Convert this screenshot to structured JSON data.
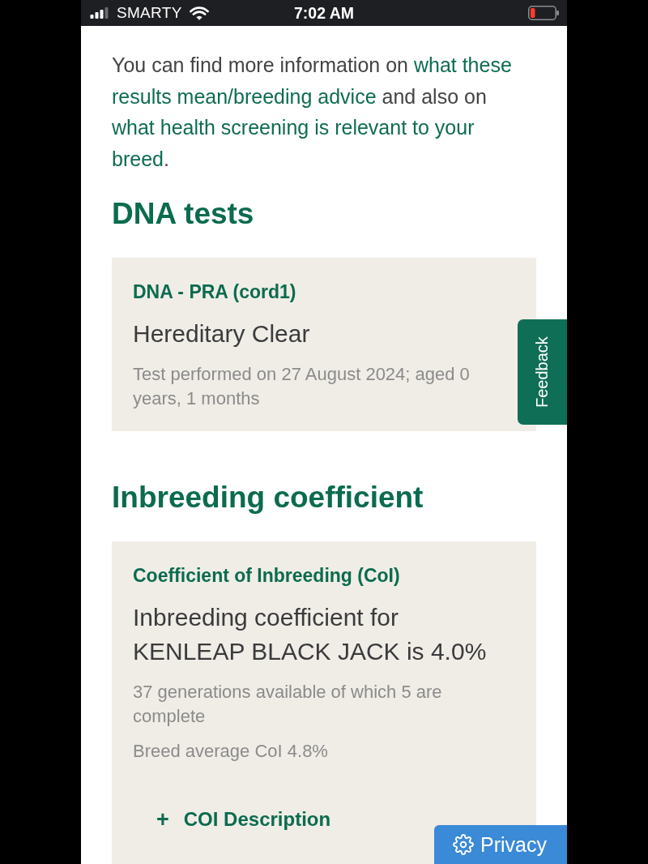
{
  "status_bar": {
    "carrier": "SMARTY",
    "time": "7:02 AM"
  },
  "intro": {
    "lines": [
      [
        {
          "text": "You can find more information on ",
          "kind": "text"
        },
        {
          "text": "what these",
          "kind": "link"
        }
      ],
      [
        {
          "text": "results mean/breeding advice",
          "kind": "link"
        },
        {
          "text": " and also on",
          "kind": "text"
        }
      ],
      [
        {
          "text": "what health screening is relevant to your",
          "kind": "link"
        }
      ],
      [
        {
          "text": "breed",
          "kind": "link"
        },
        {
          "text": ".",
          "kind": "text"
        }
      ]
    ]
  },
  "sections": [
    {
      "heading": "DNA tests",
      "cards": [
        {
          "title": "DNA - PRA (cord1)",
          "result": "Hereditary Clear",
          "notes": [
            "Test performed on 27 August 2024; aged 0 years, 1 months"
          ]
        }
      ]
    },
    {
      "heading": "Inbreeding coefficient",
      "cards": [
        {
          "title": "Coefficient of Inbreeding (CoI)",
          "result": "Inbreeding coefficient for KENLEAP BLACK JACK is 4.0%",
          "notes": [
            "37 generations available of which 5 are complete",
            "Breed average CoI 4.8%"
          ],
          "toggle": {
            "symbol": "+",
            "label": "COI Description"
          }
        }
      ]
    }
  ],
  "feedback_tab": {
    "label": "Feedback"
  },
  "privacy_button": {
    "label": "Privacy"
  }
}
